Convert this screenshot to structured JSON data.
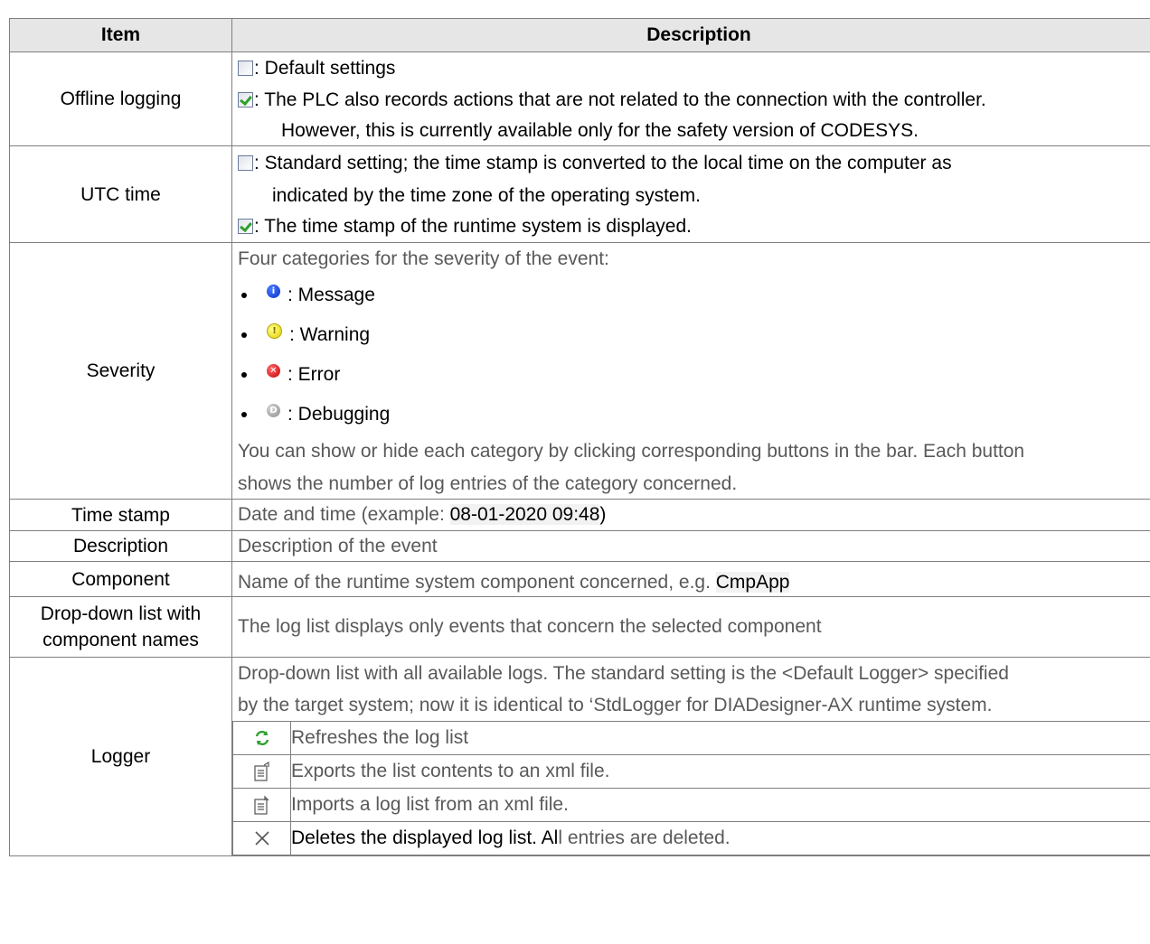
{
  "header": {
    "item": "Item",
    "description": "Description"
  },
  "offline_logging": {
    "item": "Offline logging",
    "unchecked": ": Default settings",
    "checked": ": The PLC also records actions that are not related to the connection with the controller.",
    "checked_cont": "However, this is currently available only for the safety version of CODESYS."
  },
  "utc_time": {
    "item": "UTC time",
    "unchecked": ": Standard setting; the time stamp is converted to the local time on the computer as",
    "unchecked_cont": "indicated by the time zone of the operating system.",
    "checked": ": The time stamp of the runtime system is displayed."
  },
  "severity": {
    "item": "Severity",
    "intro": "Four categories for the severity of the event:",
    "items": [
      {
        "label": ": Message",
        "icon": "info-icon",
        "glyph": "i"
      },
      {
        "label": ": Warning",
        "icon": "warning-icon",
        "glyph": "!"
      },
      {
        "label": ": Error",
        "icon": "error-icon",
        "glyph": "✕"
      },
      {
        "label": ": Debugging",
        "icon": "debug-icon",
        "glyph": "D"
      }
    ],
    "note_line1": "You can show or hide each category by clicking corresponding buttons in the bar. Each button",
    "note_line2": "shows the number of log entries of the category concerned."
  },
  "time_stamp": {
    "item": "Time stamp",
    "prefix": "Date and time (example: ",
    "example": "08-01-2020 09:48",
    "suffix": ")"
  },
  "description_row": {
    "item": "Description",
    "text": "Description of the event"
  },
  "component": {
    "item": "Component",
    "prefix": "Name of the runtime system component concerned, e.g. ",
    "example": "CmpApp"
  },
  "dropdown": {
    "item_line1": "Drop-down list with",
    "item_line2": "component names",
    "text": "The log list displays only events that concern the selected component"
  },
  "logger": {
    "item": "Logger",
    "line1": "Drop-down list with all available logs. The standard setting is the <Default Logger> specified",
    "line2": "by the target system; now it is identical to ‘StdLogger for DIADesigner-AX runtime system.",
    "buttons": [
      {
        "icon": "refresh-icon",
        "text": "Refreshes the log list"
      },
      {
        "icon": "export-icon",
        "text": "Exports the list contents to an xml file."
      },
      {
        "icon": "import-icon",
        "text": "Imports a log list from an xml file."
      },
      {
        "icon": "delete-icon",
        "text_a": "Deletes the displayed log list. Al",
        "text_b": "l entries are deleted."
      }
    ]
  },
  "colors": {
    "header_bg": "#e7e6e6",
    "border": "#7f7f7f",
    "gray_text": "#595959",
    "check_green": "#2da12a"
  }
}
